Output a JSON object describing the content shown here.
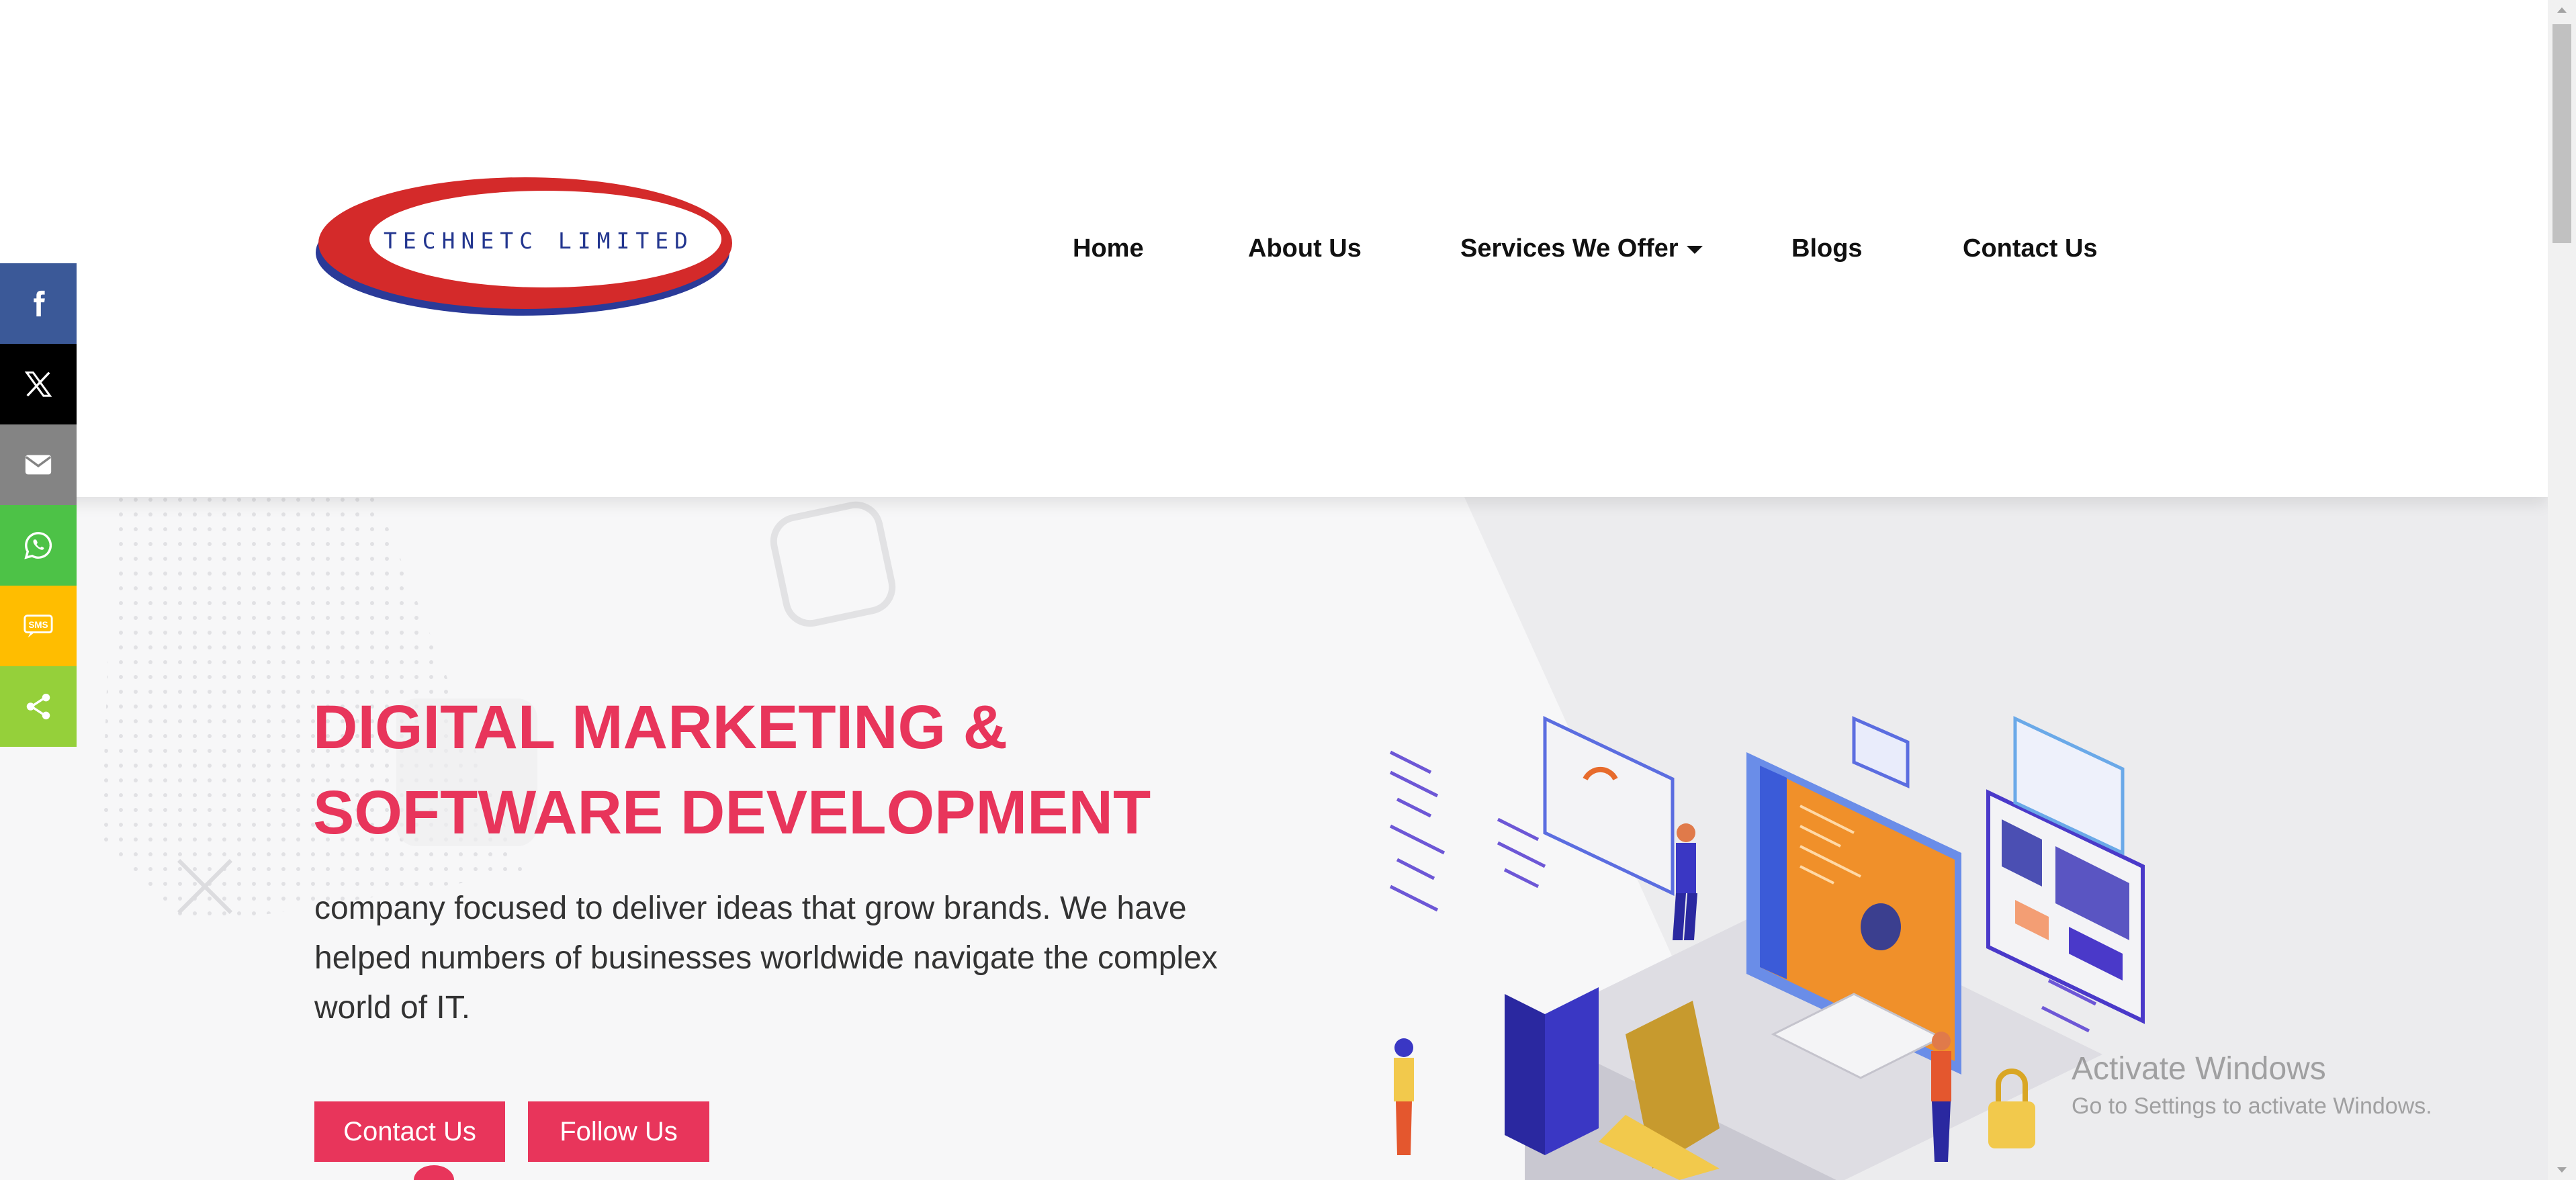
{
  "brand": {
    "logo_text": "TECHNETC LIMITED",
    "primary": "#e8355b",
    "logo_red": "#d42a2a",
    "logo_blue": "#23368f"
  },
  "nav": {
    "items": [
      "Home",
      "About Us",
      "Services We Offer",
      "Blogs",
      "Contact Us"
    ],
    "dropdown_icon": "caret-down-icon"
  },
  "hero": {
    "title": "DIGITAL MARKETING & SOFTWARE DEVELOPMENT",
    "text": "company focused to deliver ideas that grow brands. We have helped numbers of businesses worldwide navigate the complex world of IT.",
    "buttons": {
      "contact": "Contact Us",
      "follow": "Follow Us"
    },
    "illustration": "isometric-developer-workspace-illustration"
  },
  "share": {
    "items": [
      {
        "network": "facebook",
        "icon": "facebook-icon",
        "color": "#3b5998"
      },
      {
        "network": "x",
        "icon": "x-icon",
        "color": "#000000"
      },
      {
        "network": "email",
        "icon": "email-icon",
        "color": "#848484"
      },
      {
        "network": "whatsapp",
        "icon": "whatsapp-icon",
        "color": "#4dc247"
      },
      {
        "network": "sms",
        "icon": "sms-icon",
        "color": "#ffbd00"
      },
      {
        "network": "share",
        "icon": "share-icon",
        "color": "#95d03a"
      }
    ],
    "sms_label": "SMS"
  },
  "watermark": {
    "title": "Activate Windows",
    "subtitle": "Go to Settings to activate Windows."
  }
}
